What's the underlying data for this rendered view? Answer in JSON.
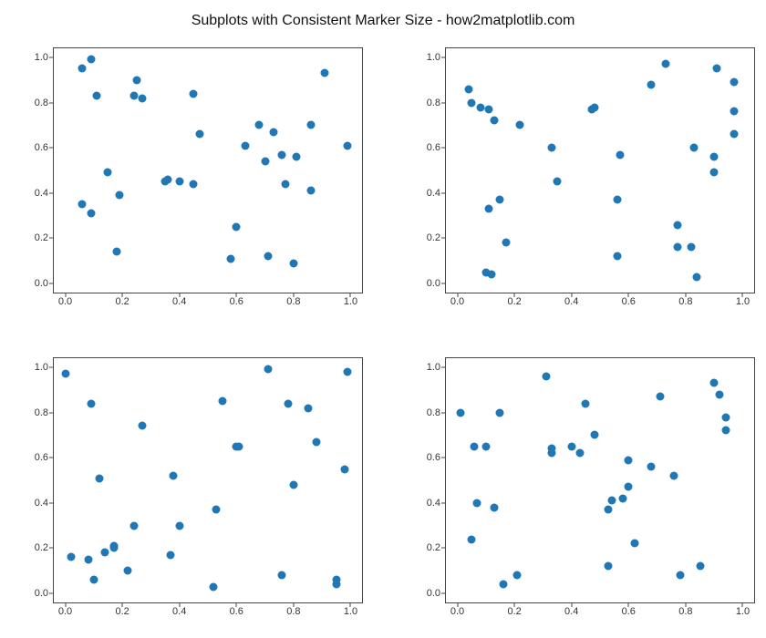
{
  "title": "Subplots with Consistent Marker Size - how2matplotlib.com",
  "axis": {
    "xticks": [
      0.0,
      0.2,
      0.4,
      0.6,
      0.8,
      1.0
    ],
    "yticks": [
      0.0,
      0.2,
      0.4,
      0.6,
      0.8,
      1.0
    ],
    "xlim": [
      -0.04,
      1.04
    ],
    "ylim": [
      -0.04,
      1.04
    ]
  },
  "marker_color": "#1f77b4",
  "chart_data": [
    {
      "type": "scatter",
      "title": "",
      "xlabel": "",
      "ylabel": "",
      "xlim": [
        -0.04,
        1.04
      ],
      "ylim": [
        -0.04,
        1.04
      ],
      "x": [
        0.06,
        0.06,
        0.09,
        0.09,
        0.11,
        0.15,
        0.18,
        0.19,
        0.24,
        0.25,
        0.27,
        0.35,
        0.36,
        0.4,
        0.45,
        0.45,
        0.47,
        0.58,
        0.6,
        0.63,
        0.68,
        0.7,
        0.71,
        0.73,
        0.76,
        0.77,
        0.8,
        0.81,
        0.86,
        0.86,
        0.91,
        0.99
      ],
      "y": [
        0.35,
        0.95,
        0.31,
        0.99,
        0.83,
        0.49,
        0.14,
        0.39,
        0.83,
        0.9,
        0.82,
        0.45,
        0.46,
        0.45,
        0.44,
        0.84,
        0.66,
        0.11,
        0.25,
        0.61,
        0.7,
        0.54,
        0.12,
        0.67,
        0.57,
        0.44,
        0.09,
        0.56,
        0.7,
        0.41,
        0.93,
        0.61
      ]
    },
    {
      "type": "scatter",
      "title": "",
      "xlabel": "",
      "ylabel": "",
      "xlim": [
        -0.04,
        1.04
      ],
      "ylim": [
        -0.04,
        1.04
      ],
      "x": [
        0.04,
        0.05,
        0.08,
        0.1,
        0.11,
        0.11,
        0.12,
        0.13,
        0.15,
        0.17,
        0.22,
        0.33,
        0.35,
        0.47,
        0.48,
        0.56,
        0.56,
        0.57,
        0.68,
        0.73,
        0.77,
        0.77,
        0.82,
        0.83,
        0.84,
        0.9,
        0.9,
        0.91,
        0.97,
        0.97,
        0.97
      ],
      "y": [
        0.86,
        0.8,
        0.78,
        0.05,
        0.33,
        0.77,
        0.04,
        0.72,
        0.37,
        0.18,
        0.7,
        0.6,
        0.45,
        0.77,
        0.78,
        0.12,
        0.37,
        0.57,
        0.88,
        0.97,
        0.26,
        0.16,
        0.16,
        0.6,
        0.03,
        0.49,
        0.56,
        0.95,
        0.66,
        0.76,
        0.89
      ]
    },
    {
      "type": "scatter",
      "title": "",
      "xlabel": "",
      "ylabel": "",
      "xlim": [
        -0.04,
        1.04
      ],
      "ylim": [
        -0.04,
        1.04
      ],
      "x": [
        0.0,
        0.02,
        0.08,
        0.09,
        0.1,
        0.12,
        0.14,
        0.17,
        0.17,
        0.22,
        0.24,
        0.27,
        0.37,
        0.38,
        0.4,
        0.52,
        0.53,
        0.55,
        0.6,
        0.61,
        0.71,
        0.76,
        0.78,
        0.8,
        0.85,
        0.88,
        0.95,
        0.95,
        0.98,
        0.99
      ],
      "y": [
        0.97,
        0.16,
        0.15,
        0.84,
        0.06,
        0.51,
        0.18,
        0.21,
        0.2,
        0.1,
        0.3,
        0.74,
        0.17,
        0.52,
        0.3,
        0.03,
        0.37,
        0.85,
        0.65,
        0.65,
        0.99,
        0.08,
        0.84,
        0.48,
        0.82,
        0.67,
        0.04,
        0.06,
        0.55,
        0.98
      ]
    },
    {
      "type": "scatter",
      "title": "",
      "xlabel": "",
      "ylabel": "",
      "xlim": [
        -0.04,
        1.04
      ],
      "ylim": [
        -0.04,
        1.04
      ],
      "x": [
        0.01,
        0.05,
        0.06,
        0.07,
        0.1,
        0.13,
        0.15,
        0.16,
        0.21,
        0.31,
        0.33,
        0.33,
        0.4,
        0.43,
        0.45,
        0.48,
        0.53,
        0.53,
        0.54,
        0.58,
        0.6,
        0.6,
        0.62,
        0.68,
        0.71,
        0.76,
        0.78,
        0.85,
        0.9,
        0.92,
        0.94,
        0.94
      ],
      "y": [
        0.8,
        0.24,
        0.65,
        0.4,
        0.65,
        0.38,
        0.8,
        0.04,
        0.08,
        0.96,
        0.62,
        0.64,
        0.65,
        0.62,
        0.84,
        0.7,
        0.12,
        0.37,
        0.41,
        0.42,
        0.47,
        0.59,
        0.22,
        0.56,
        0.87,
        0.52,
        0.08,
        0.12,
        0.93,
        0.88,
        0.72,
        0.78
      ]
    }
  ]
}
